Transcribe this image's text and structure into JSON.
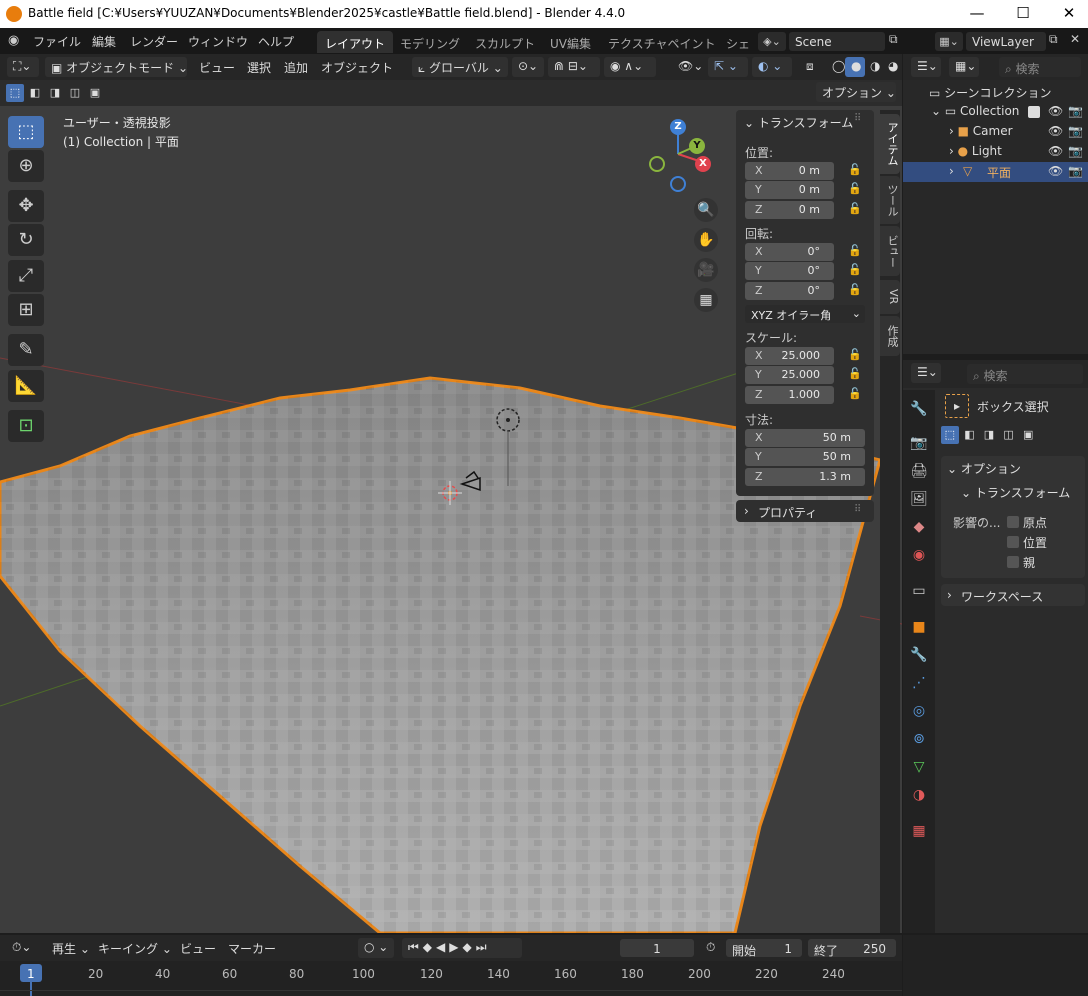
{
  "window": {
    "title": "Battle field [C:¥Users¥YUUZAN¥Documents¥Blender2025¥castle¥Battle field.blend] - Blender 4.4.0",
    "minimize": "—",
    "maximize": "☐",
    "close": "✕"
  },
  "menu": {
    "items": [
      "ファイル",
      "編集",
      "レンダー",
      "ウィンドウ",
      "ヘルプ"
    ]
  },
  "workspaces": {
    "tabs": [
      "レイアウト",
      "モデリング",
      "スカルプト",
      "UV編集",
      "テクスチャペイント",
      "シェ"
    ],
    "active": "レイアウト"
  },
  "scene": {
    "name": "Scene",
    "view_layer": "ViewLayer"
  },
  "viewport_header": {
    "mode": "オブジェクトモード",
    "menus": [
      "ビュー",
      "選択",
      "追加",
      "オブジェクト"
    ],
    "orientation": "グローバル",
    "options": "オプション"
  },
  "viewport": {
    "view_name": "ユーザー・透視投影",
    "collection_info": "(1) Collection | 平面"
  },
  "gizmo": {
    "x": "X",
    "y": "Y",
    "z": "Z"
  },
  "npanel": {
    "transform_title": "トランスフォーム",
    "location_label": "位置:",
    "location": [
      {
        "axis": "X",
        "value": "0 m"
      },
      {
        "axis": "Y",
        "value": "0 m"
      },
      {
        "axis": "Z",
        "value": "0 m"
      }
    ],
    "rotation_label": "回転:",
    "rotation": [
      {
        "axis": "X",
        "value": "0°"
      },
      {
        "axis": "Y",
        "value": "0°"
      },
      {
        "axis": "Z",
        "value": "0°"
      }
    ],
    "rotation_mode": "XYZ オイラー角",
    "scale_label": "スケール:",
    "scale": [
      {
        "axis": "X",
        "value": "25.000"
      },
      {
        "axis": "Y",
        "value": "25.000"
      },
      {
        "axis": "Z",
        "value": "1.000"
      }
    ],
    "dimensions_label": "寸法:",
    "dimensions": [
      {
        "axis": "X",
        "value": "50 m"
      },
      {
        "axis": "Y",
        "value": "50 m"
      },
      {
        "axis": "Z",
        "value": "1.3 m"
      }
    ],
    "properties_title": "プロパティ",
    "side_tabs": [
      "アイテム",
      "ツール",
      "ビュー",
      "VR",
      "作成"
    ]
  },
  "outliner": {
    "search_placeholder": "検索",
    "root": "シーンコレクション",
    "collection": "Collection",
    "items": [
      "Camer",
      "Light",
      "平面"
    ]
  },
  "properties": {
    "search_placeholder": "検索",
    "tool_name": "ボックス選択",
    "options_title": "オプション",
    "transform_title": "トランスフォーム",
    "affect_label": "影響の...",
    "affect_options": [
      "原点",
      "位置",
      "親"
    ],
    "workspace_title": "ワークスペース"
  },
  "timeline": {
    "playback": "再生",
    "keying": "キーイング",
    "view": "ビュー",
    "marker": "マーカー",
    "current_frame": "1",
    "start_label": "開始",
    "start": "1",
    "end_label": "終了",
    "end": "250",
    "ruler": [
      "1",
      "20",
      "40",
      "60",
      "80",
      "100",
      "120",
      "140",
      "160",
      "180",
      "200",
      "220",
      "240"
    ]
  },
  "colors": {
    "accent": "#4772b3",
    "selection": "#e8861a",
    "x_axis": "#e0424e",
    "y_axis": "#8ab53e",
    "z_axis": "#3f80d5"
  }
}
